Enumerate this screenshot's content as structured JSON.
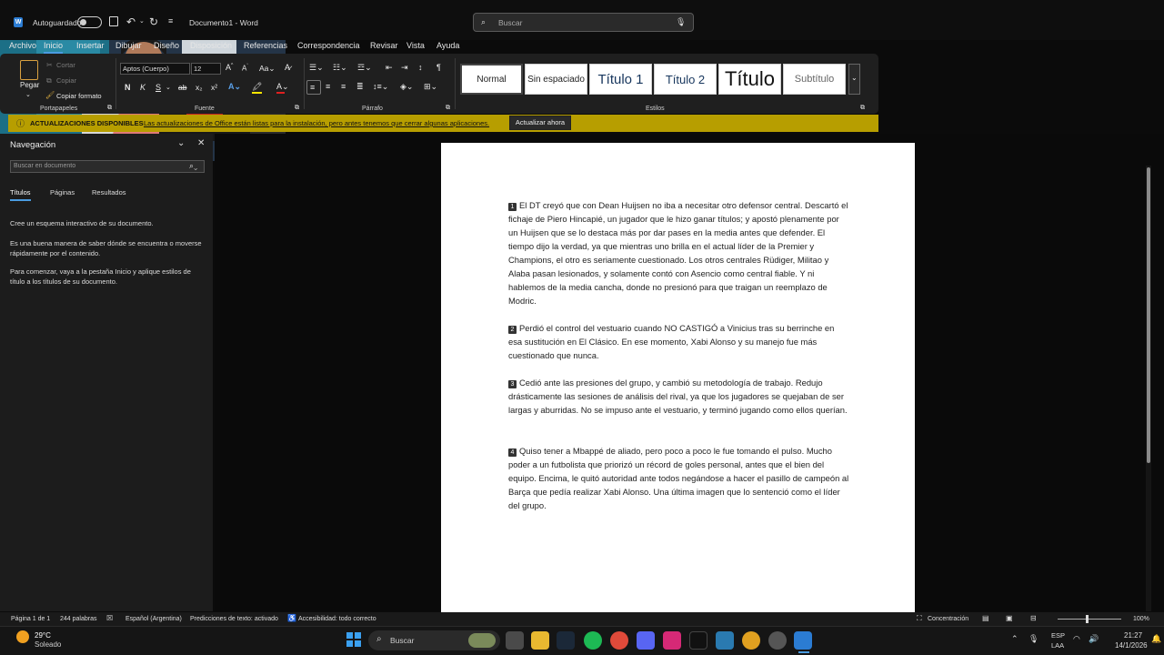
{
  "titlebar": {
    "autosave": "Autoguardado",
    "doc_title": "Documento1 - Word",
    "search_placeholder": "Buscar"
  },
  "menu": [
    "Archivo",
    "Inicio",
    "Insertar",
    "Dibujar",
    "Diseño",
    "Disposición",
    "Referencias",
    "Correspondencia",
    "Revisar",
    "Vista",
    "Ayuda"
  ],
  "ribbon": {
    "clipboard": {
      "paste": "Pegar",
      "cut": "Cortar",
      "copy": "Copiar",
      "format_painter": "Copiar formato",
      "label": "Portapapeles"
    },
    "font": {
      "name": "Aptos (Cuerpo)",
      "size": "12",
      "label": "Fuente",
      "bold": "N",
      "italic": "K",
      "underline": "S",
      "strike": "ab",
      "sub": "x₂",
      "sup": "x²"
    },
    "paragraph": {
      "label": "Párrafo"
    },
    "styles": {
      "items": [
        "Normal",
        "Sin espaciado",
        "Título 1",
        "Título 2",
        "Título",
        "Subtítulo"
      ],
      "label": "Estilos"
    }
  },
  "update_bar": {
    "title": "ACTUALIZACIONES DISPONIBLES",
    "message": "Las actualizaciones de Office están listas para la instalación, pero antes tenemos que cerrar algunas aplicaciones.",
    "button": "Actualizar ahora"
  },
  "navigation": {
    "title": "Navegación",
    "search_placeholder": "Buscar en documento",
    "tabs": [
      "Títulos",
      "Páginas",
      "Resultados"
    ],
    "help": [
      "Cree un esquema interactivo de su documento.",
      "Es una buena manera de saber dónde se encuentra o moverse rápidamente por el contenido.",
      "Para comenzar, vaya a la pestaña Inicio y aplique estilos de título a los títulos de su documento."
    ]
  },
  "document": {
    "paragraphs": [
      {
        "num": "1",
        "text": "El DT creyó que con Dean Huijsen no iba a necesitar otro defensor central. Descartó el fichaje de Piero Hincapié, un jugador que le hizo ganar títulos; y apostó plenamente por un Huijsen que se lo destaca más por dar pases en la media antes que defender. El tiempo dijo la verdad, ya que mientras uno brilla en el actual líder de la Premier y Champions, el otro es seriamente cuestionado. Los otros centrales Rüdiger, Militao y Alaba pasan lesionados, y solamente contó con Asencio como central fiable. Y ni hablemos de la media cancha, donde no presionó para que traigan un reemplazo de Modric."
      },
      {
        "num": "2",
        "text": "Perdió el control del vestuario cuando NO CASTIGÓ a Vinicius tras su berrinche en esa sustitución en El Clásico. En ese momento, Xabi Alonso y su manejo fue más cuestionado que nunca."
      },
      {
        "num": "3",
        "text": "Cedió ante las presiones del grupo, y cambió su metodología de trabajo. Redujo drásticamente las sesiones de análisis del rival, ya que los jugadores se quejaban de ser largas y aburridas. No se impuso ante el vestuario, y terminó jugando como ellos querían."
      },
      {
        "num": "4",
        "text": "Quiso tener a Mbappé de aliado, pero poco a poco le fue tomando el pulso. Mucho poder a un futbolista que priorizó un récord de goles personal, antes que el bien del equipo. Encima, le quitó autoridad ante todos negándose a hacer el pasillo de campeón al Barça que pedía realizar Xabi Alonso. Una última imagen que lo sentenció como el líder del grupo."
      }
    ]
  },
  "status": {
    "page": "Página 1 de 1",
    "words": "244 palabras",
    "language": "Español (Argentina)",
    "predictions": "Predicciones de texto: activado",
    "accessibility": "Accesibilidad: todo correcto",
    "focus": "Concentración",
    "zoom": "100%"
  },
  "taskbar": {
    "weather_temp": "29°C",
    "weather_desc": "Soleado",
    "search": "Buscar",
    "lang1": "ESP",
    "lang2": "LAA",
    "time": "21:27",
    "date": "14/1/2026"
  },
  "colors": {
    "accent": "#4a9be0",
    "update_bar": "#b79e00",
    "word_blue": "#2b7cd3"
  }
}
